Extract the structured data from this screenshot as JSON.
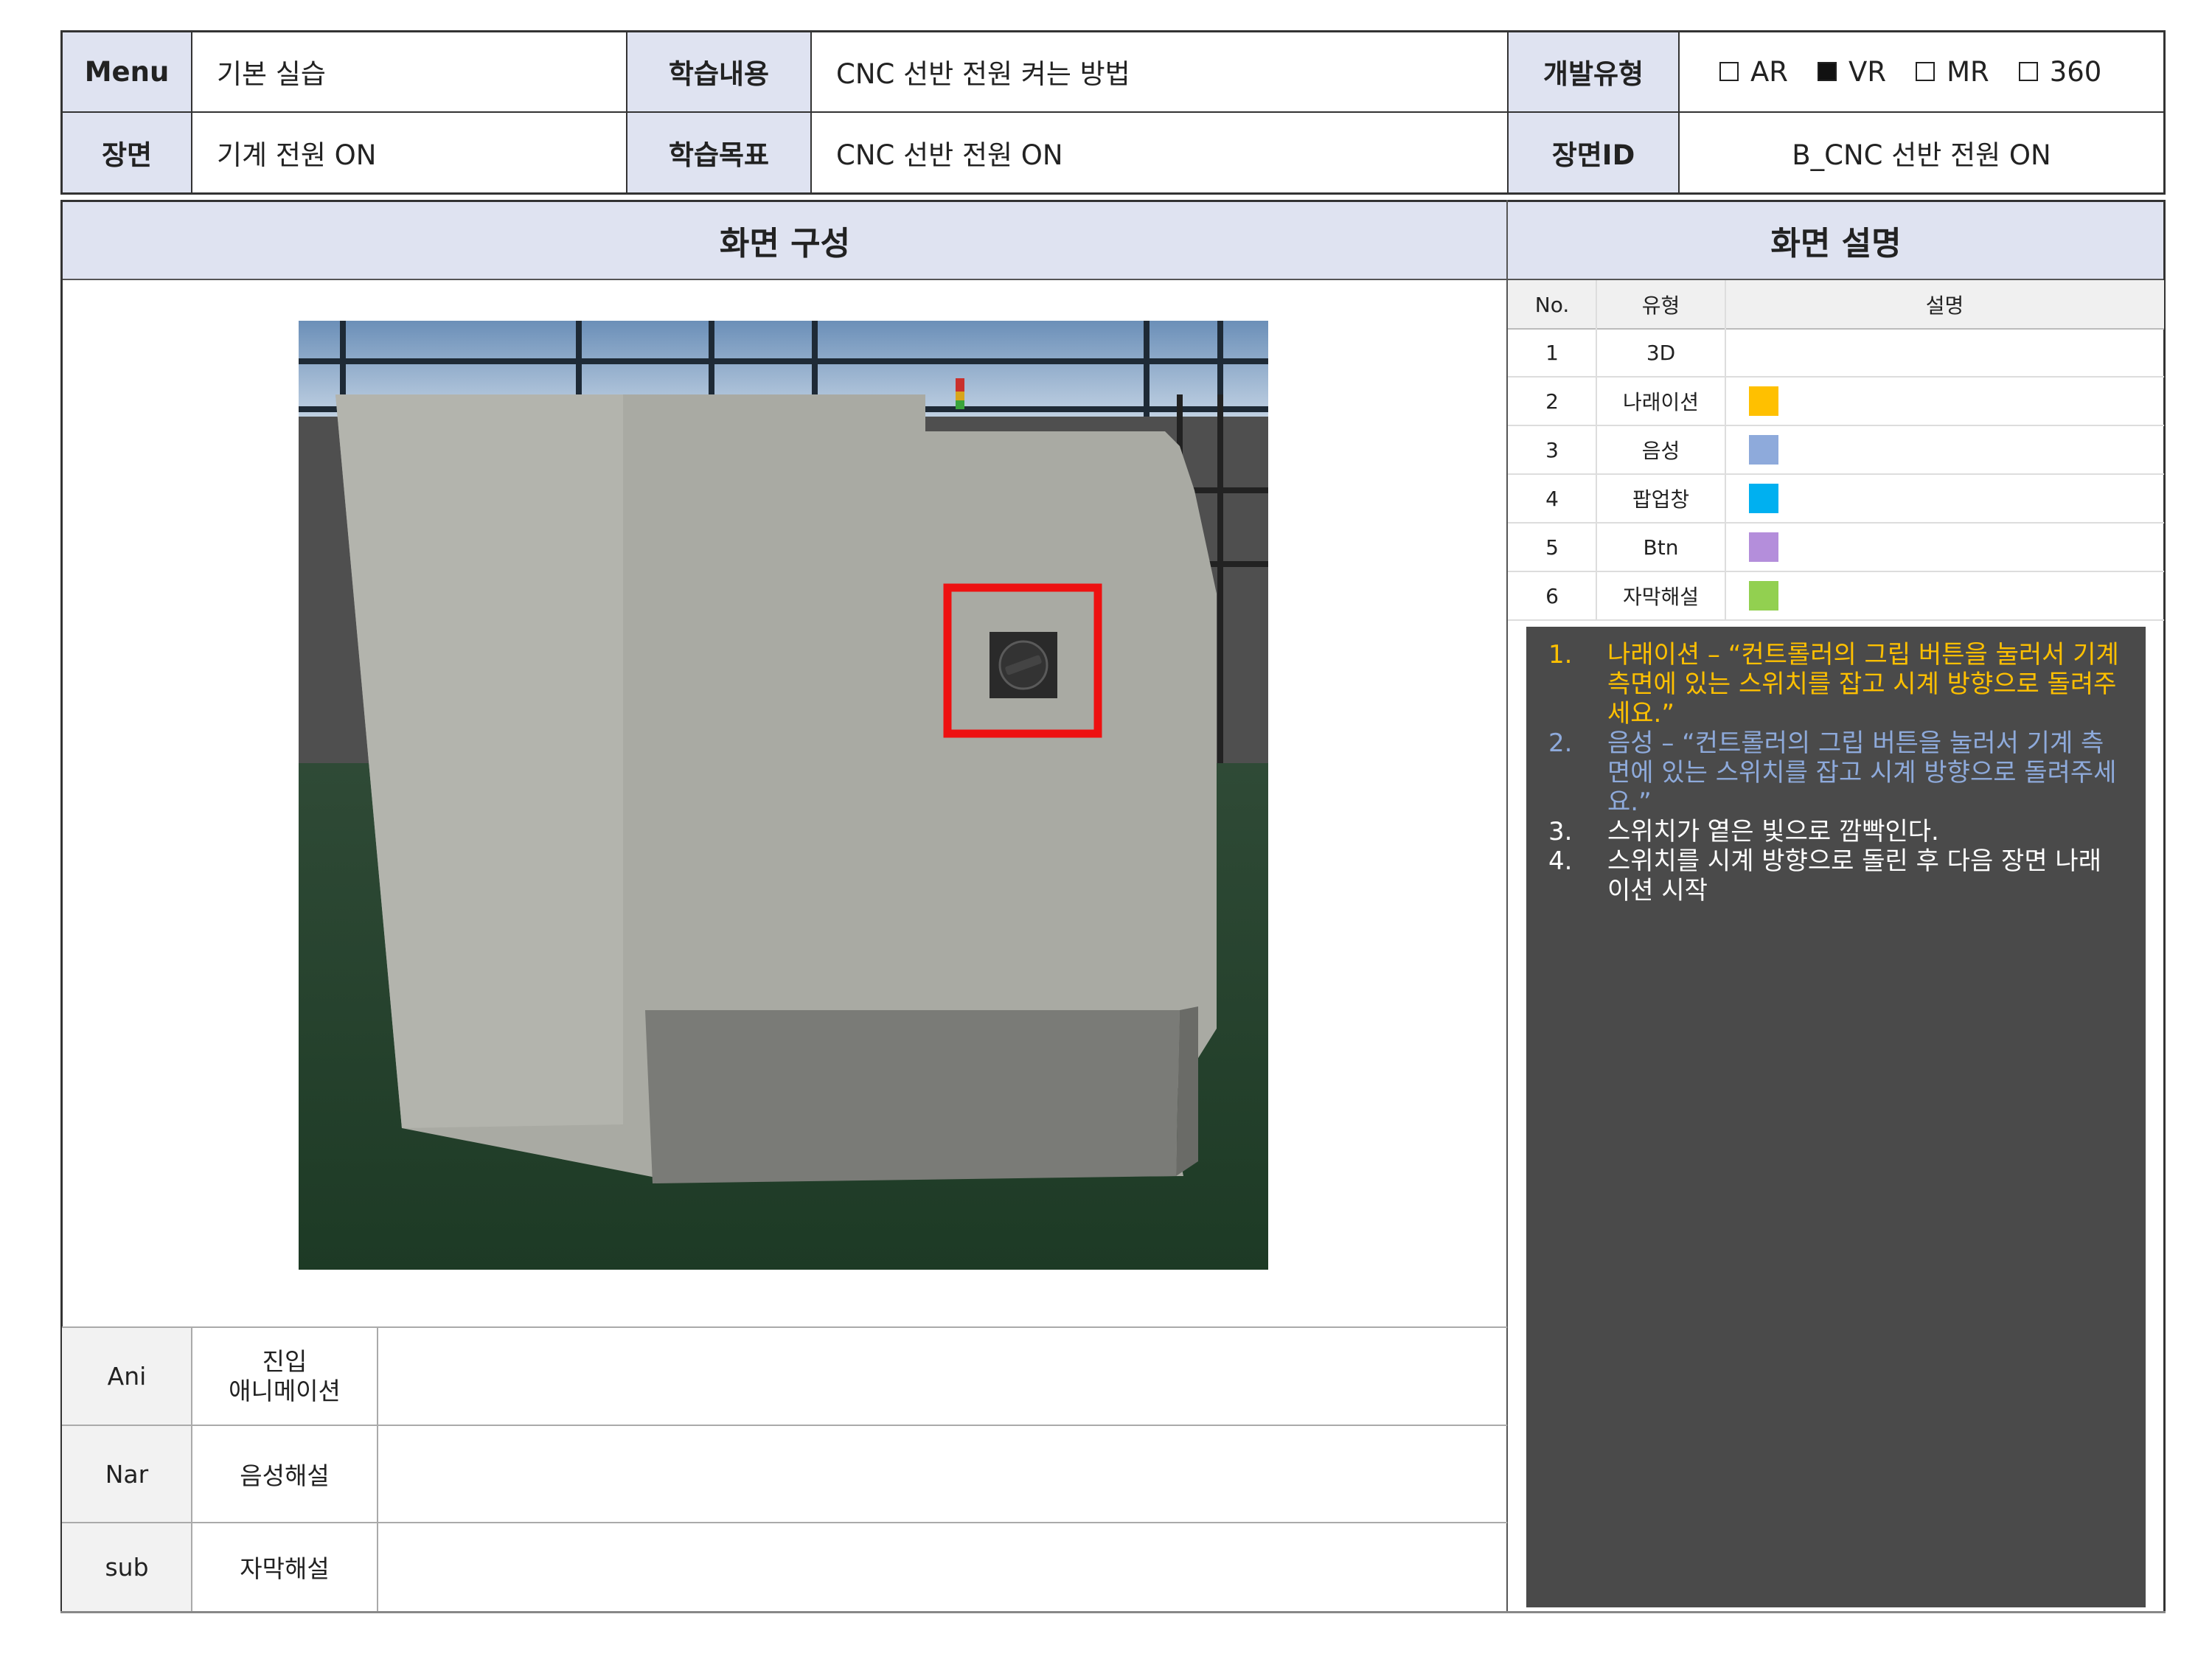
{
  "header": {
    "menu_label": "Menu",
    "menu_value": "기본 실습",
    "content_label": "학습내용",
    "content_value": "CNC 선반 전원 켜는 방법",
    "devtype_label": "개발유형",
    "devtypes": [
      {
        "label": "AR",
        "checked": false
      },
      {
        "label": "VR",
        "checked": true
      },
      {
        "label": "MR",
        "checked": false
      },
      {
        "label": "360",
        "checked": false
      }
    ],
    "scene_label": "장면",
    "scene_value": "기계 전원 ON",
    "goal_label": "학습목표",
    "goal_value": "CNC 선반 전원 ON",
    "sceneid_label": "장면ID",
    "sceneid_value": "B_CNC 선반 전원 ON"
  },
  "sections": {
    "composition_title": "화면 구성",
    "description_title": "화면 설명"
  },
  "legend": {
    "columns": [
      "No.",
      "유형",
      "설명"
    ],
    "rows": [
      {
        "no": "1",
        "type": "3D",
        "color": ""
      },
      {
        "no": "2",
        "type": "나래이션",
        "color": "#ffc000"
      },
      {
        "no": "3",
        "type": "음성",
        "color": "#8eaadb"
      },
      {
        "no": "4",
        "type": "팝업창",
        "color": "#00b0f0"
      },
      {
        "no": "5",
        "type": "Btn",
        "color": "#b48edb"
      },
      {
        "no": "6",
        "type": "자막해설",
        "color": "#92d050"
      }
    ]
  },
  "descriptions": [
    {
      "num": "1.",
      "text": "나래이션 – “컨트롤러의 그립 버튼을 눌러서 기계 측면에 있는 스위치를 잡고 시계 방향으로 돌려주세요.”",
      "color": "#ffc000"
    },
    {
      "num": "2.",
      "text": "음성 – “컨트롤러의 그립 버튼을 눌러서 기계 측면에 있는 스위치를 잡고 시계 방향으로 돌려주세요.”",
      "color": "#8eaadb"
    },
    {
      "num": "3.",
      "text": "스위치가 옅은 빛으로 깜빡인다.",
      "color": "#ffffff"
    },
    {
      "num": "4.",
      "text": "스위치를 시계 방향으로 돌린 후 다음 장면 나래이션 시작",
      "color": "#ffffff"
    }
  ],
  "bottom_rows": [
    {
      "code": "Ani",
      "label": "진입\n애니메이션",
      "content": ""
    },
    {
      "code": "Nar",
      "label": "음성해설",
      "content": ""
    },
    {
      "code": "sub",
      "label": "자막해설",
      "content": ""
    }
  ],
  "colors": {
    "header_bg": "#dfe3f1",
    "panel_bg": "#4a4a4a",
    "highlight_box": "#ee1111"
  }
}
